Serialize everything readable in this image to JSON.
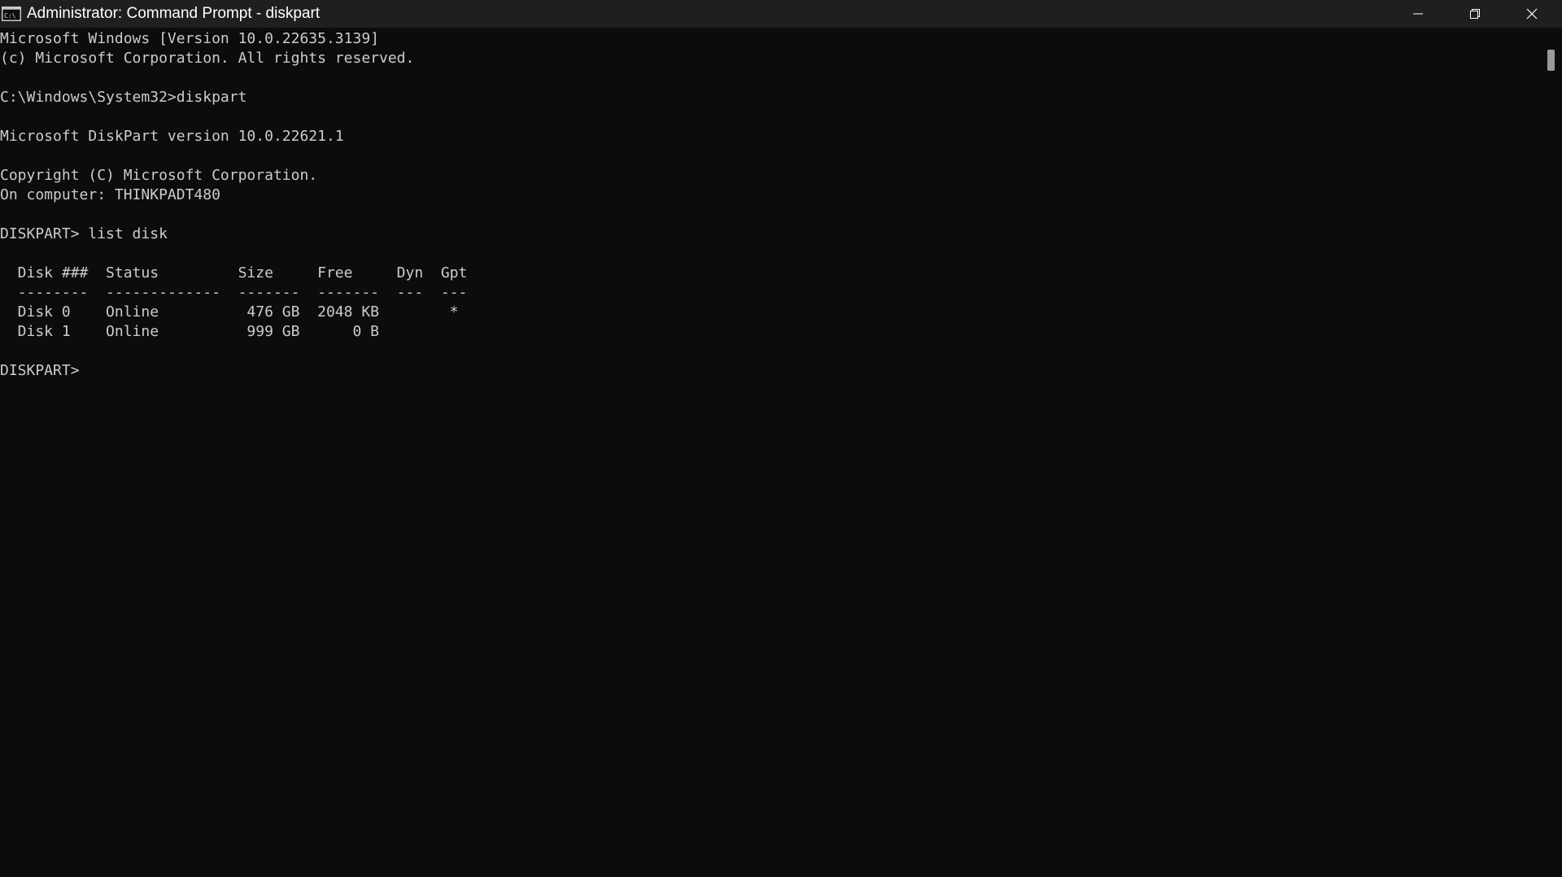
{
  "window": {
    "title": "Administrator: Command Prompt - diskpart",
    "icon": "cmd-icon",
    "controls": {
      "minimize": "minimize-icon",
      "restore": "restore-icon",
      "close": "close-icon"
    }
  },
  "console": {
    "lines": [
      "Microsoft Windows [Version 10.0.22635.3139]",
      "(c) Microsoft Corporation. All rights reserved.",
      "",
      "C:\\Windows\\System32>diskpart",
      "",
      "Microsoft DiskPart version 10.0.22621.1",
      "",
      "Copyright (C) Microsoft Corporation.",
      "On computer: THINKPADT480",
      "",
      "DISKPART> list disk",
      "",
      "  Disk ###  Status         Size     Free     Dyn  Gpt",
      "  --------  -------------  -------  -------  ---  ---",
      "  Disk 0    Online          476 GB  2048 KB        *",
      "  Disk 1    Online          999 GB      0 B",
      "",
      "DISKPART> "
    ]
  },
  "colors": {
    "background": "#0c0c0c",
    "titlebar": "#1f1f1f",
    "text": "#cccccc",
    "title_text": "#ffffff"
  }
}
